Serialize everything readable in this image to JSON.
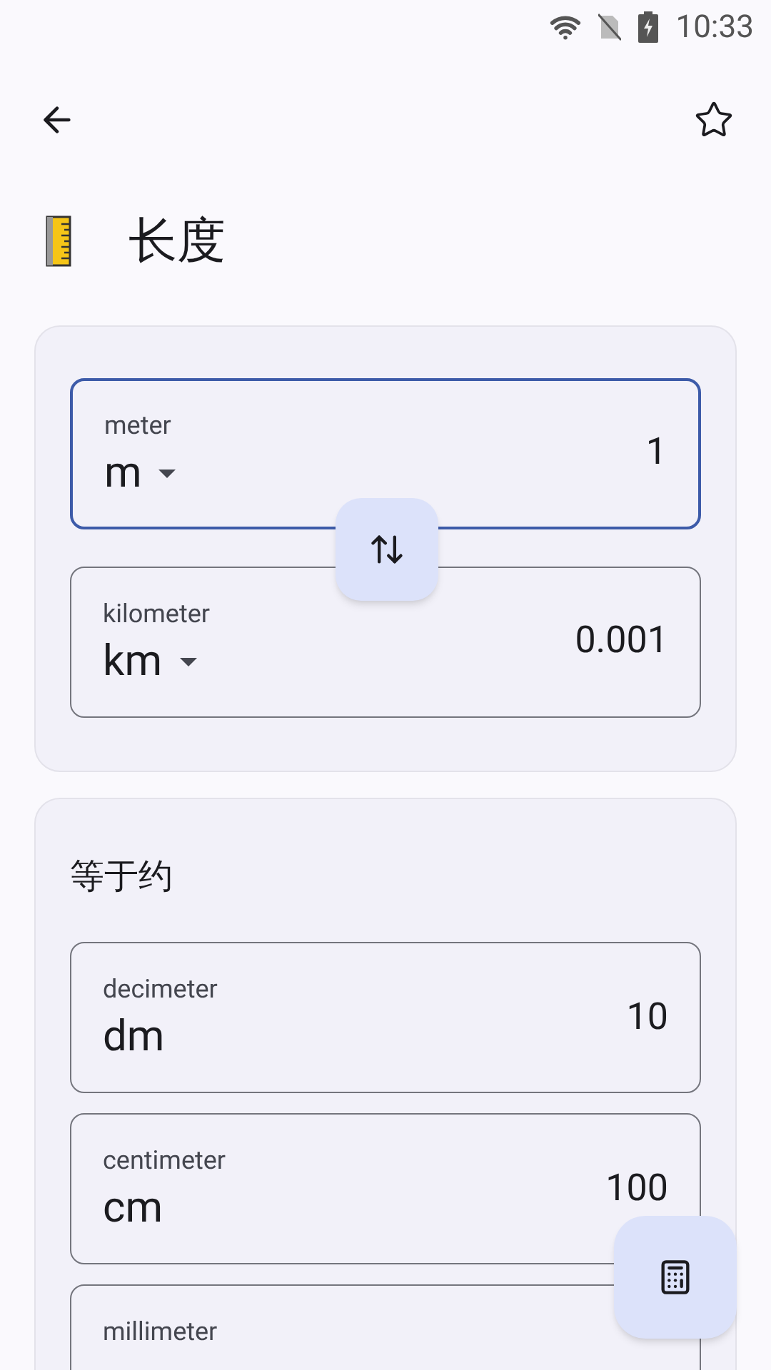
{
  "status_bar": {
    "time": "10:33"
  },
  "title": "长度",
  "converter": {
    "fields": [
      {
        "label": "meter",
        "unit": "m",
        "value": "1",
        "focused": true
      },
      {
        "label": "kilometer",
        "unit": "km",
        "value": "0.001",
        "focused": false
      }
    ]
  },
  "results": {
    "heading": "等于约",
    "items": [
      {
        "label": "decimeter",
        "unit": "dm",
        "value": "10"
      },
      {
        "label": "centimeter",
        "unit": "cm",
        "value": "100"
      },
      {
        "label": "millimeter"
      }
    ]
  }
}
